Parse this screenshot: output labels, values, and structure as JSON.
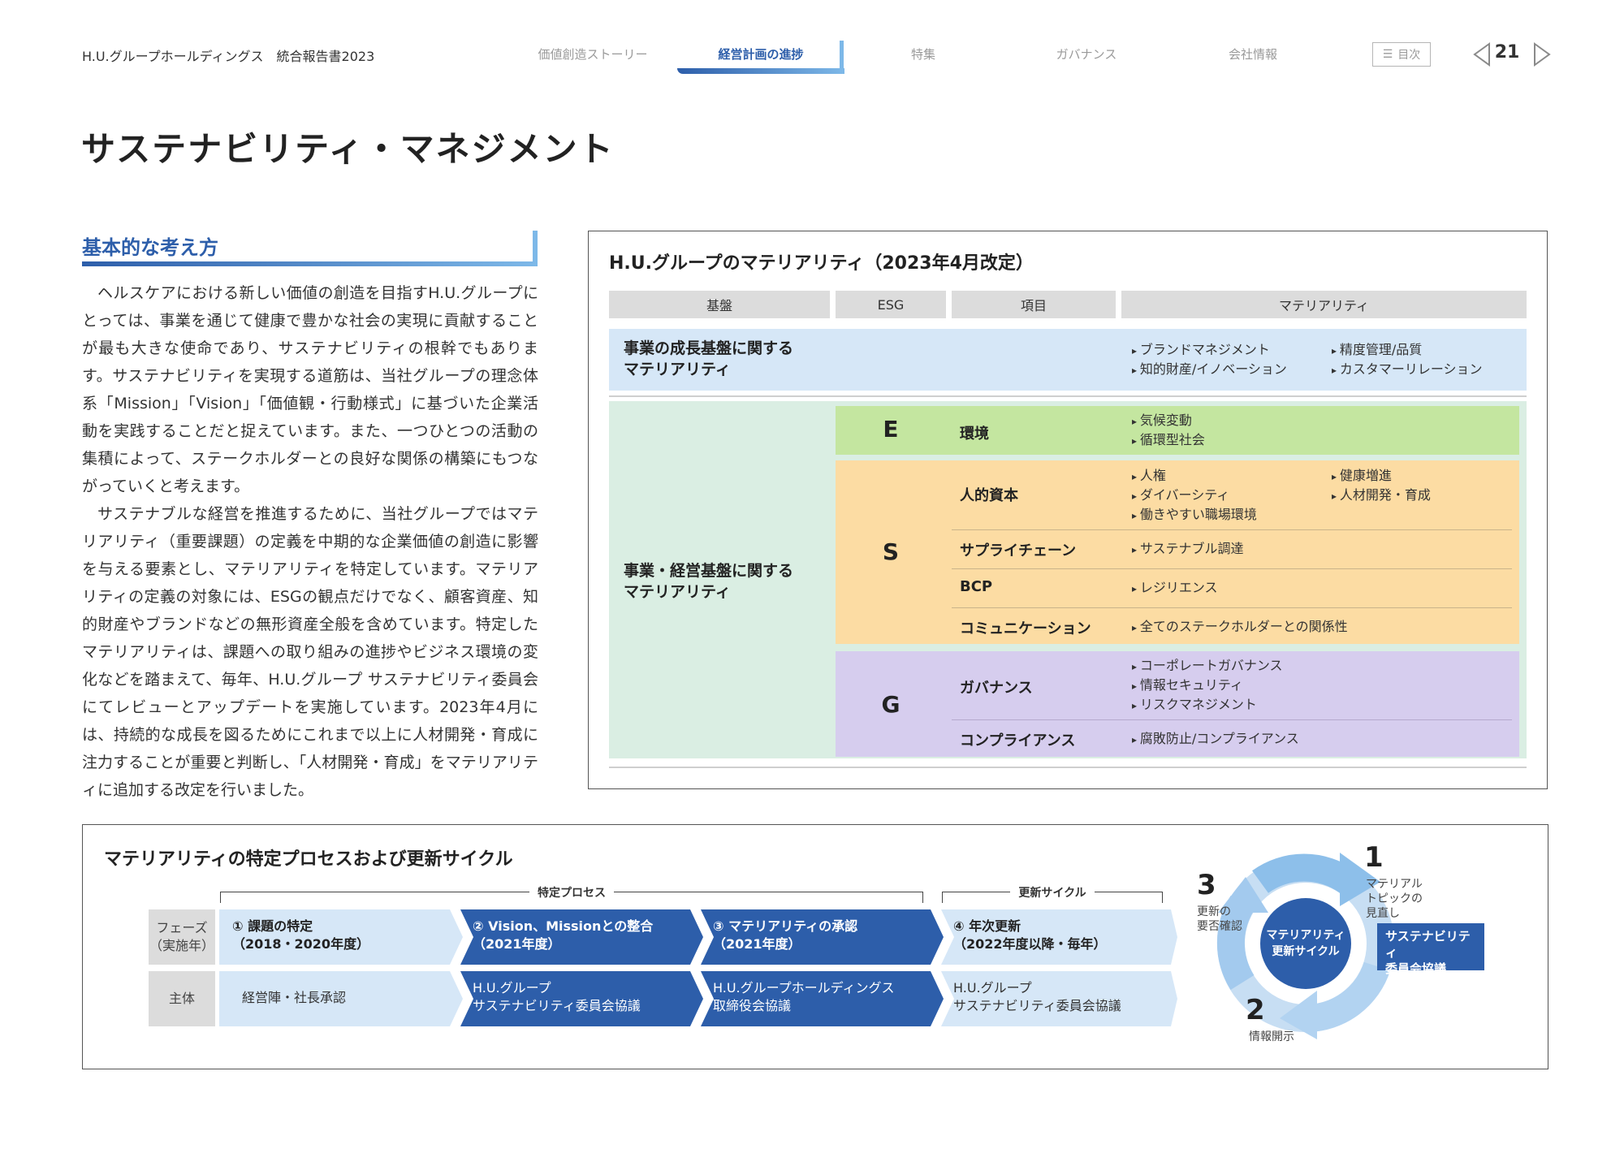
{
  "header": {
    "company": "H.U.グループホールディングス　統合報告書2023",
    "nav": [
      {
        "label": "価値創造ストーリー"
      },
      {
        "label": "経営計画の進捗"
      },
      {
        "label": "特集"
      },
      {
        "label": "ガバナンス"
      },
      {
        "label": "会社情報"
      }
    ],
    "toc_label": "目次",
    "page_number": "21"
  },
  "page_title": "サステナビリティ・マネジメント",
  "basic_policy": {
    "heading": "基本的な考え方",
    "paragraphs": [
      "ヘルスケアにおける新しい価値の創造を目指すH.U.グループにとっては、事業を通じて健康で豊かな社会の実現に貢献することが最も大きな使命であり、サステナビリティの根幹でもあります。サステナビリティを実現する道筋は、当社グループの理念体系「Mission」「Vision」「価値観・行動様式」に基づいた企業活動を実践することだと捉えています。また、一つひとつの活動の集積によって、ステークホルダーとの良好な関係の構築にもつながっていくと考えます。",
      "サステナブルな経営を推進するために、当社グループではマテリアリティ（重要課題）の定義を中期的な企業価値の創造に影響を与える要素とし、マテリアリティを特定しています。マテリアリティの定義の対象には、ESGの観点だけでなく、顧客資産、知的財産やブランドなどの無形資産全般を含めています。特定したマテリアリティは、課題への取り組みの進捗やビジネス環境の変化などを踏まえて、毎年、H.U.グループ サステナビリティ委員会にてレビューとアップデートを実施しています。2023年4月には、持続的な成長を図るためにこれまで以上に人材開発・育成に注力することが重要と判断し、「人材開発・育成」をマテリアリティに追加する改定を行いました。"
    ]
  },
  "materiality": {
    "title": "H.U.グループのマテリアリティ（2023年4月改定）",
    "headers": [
      "基盤",
      "ESG",
      "項目",
      "マテリアリティ"
    ],
    "growth": {
      "label_1": "事業の成長基盤に関する",
      "label_2": "マテリアリティ",
      "items": [
        "ブランドマネジメント",
        "知的財産/イノベーション",
        "精度管理/品質",
        "カスタマーリレーション"
      ]
    },
    "business": {
      "label_1": "事業・経営基盤に関する",
      "label_2": "マテリアリティ"
    },
    "E": {
      "letter": "E",
      "label": "環境",
      "items": [
        "気候変動",
        "循環型社会"
      ]
    },
    "S": {
      "letter": "S",
      "human": {
        "label": "人的資本",
        "items": [
          "人権",
          "ダイバーシティ",
          "働きやすい職場環境",
          "健康増進",
          "人材開発・育成"
        ]
      },
      "supply": {
        "label": "サプライチェーン",
        "items": [
          "サステナブル調達"
        ]
      },
      "bcp": {
        "label": "BCP",
        "items": [
          "レジリエンス"
        ]
      },
      "comm": {
        "label": "コミュニケーション",
        "items": [
          "全てのステークホルダーとの関係性"
        ]
      }
    },
    "G": {
      "letter": "G",
      "gov": {
        "label": "ガバナンス",
        "items": [
          "コーポレートガバナンス",
          "情報セキュリティ",
          "リスクマネジメント"
        ]
      },
      "comp": {
        "label": "コンプライアンス",
        "items": [
          "腐敗防止/コンプライアンス"
        ]
      }
    }
  },
  "process": {
    "title": "マテリアリティの特定プロセスおよび更新サイクル",
    "bracket_identify": "特定プロセス",
    "bracket_update": "更新サイクル",
    "phase_label_1": "フェーズ",
    "phase_label_2": "（実施年）",
    "actor_label": "主体",
    "steps": [
      {
        "title": "① 課題の特定",
        "period": "（2018・2020年度）",
        "actor_1": "経営陣・社長承認",
        "actor_2": ""
      },
      {
        "title": "② Vision、Missionとの整合",
        "period": "（2021年度）",
        "actor_1": "H.U.グループ",
        "actor_2": "サステナビリティ委員会協議"
      },
      {
        "title": "③ マテリアリティの承認",
        "period": "（2021年度）",
        "actor_1": "H.U.グループホールディングス",
        "actor_2": "取締役会協議"
      },
      {
        "title": "④ 年次更新",
        "period": "（2022年度以降・毎年）",
        "actor_1": "H.U.グループ",
        "actor_2": "サステナビリティ委員会協議"
      }
    ],
    "cycle": {
      "center_1": "マテリアリティ",
      "center_2": "更新サイクル",
      "n1": "1",
      "l1_1": "マテリアル",
      "l1_2": "トピックの",
      "l1_3": "見直し",
      "n2": "2",
      "l2": "情報開示",
      "n3": "3",
      "l3_1": "更新の",
      "l3_2": "要否確認",
      "committee_1": "サステナビリティ",
      "committee_2": "委員会協議"
    }
  },
  "colors": {
    "brand_blue": "#2d5eaa",
    "light_blue": "#d6e7f7",
    "mint": "#daeee3",
    "E_green": "#c4e6a0",
    "S_orange": "#fcdca3",
    "G_purple": "#d6cdee"
  }
}
